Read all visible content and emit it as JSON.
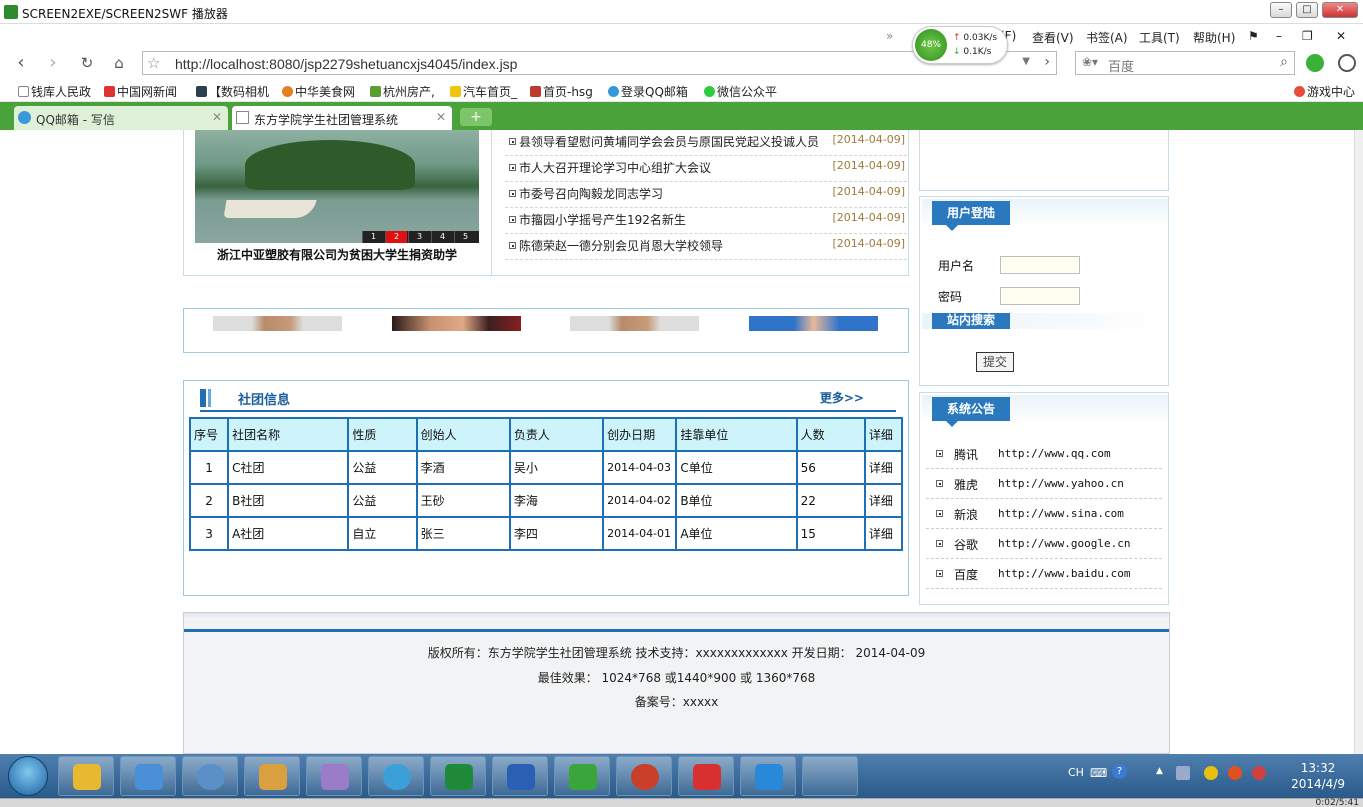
{
  "window": {
    "title": "SCREEN2EXE/SCREEN2SWF 播放器"
  },
  "menu": {
    "items": [
      "(F)",
      "查看(V)",
      "书签(A)",
      "工具(T)",
      "帮助(H)"
    ]
  },
  "nav": {
    "url": "http://localhost:8080/jsp2279shetuancxjs4045/index.jsp",
    "search_placeholder": "百度",
    "speed": {
      "percent": "48%",
      "up": "0.03K/s",
      "down": "0.1K/s"
    }
  },
  "bookmarks": [
    "钱库人民政",
    "中国网新闻",
    "【数码相机",
    "中华美食网",
    "杭州房产,",
    "汽车首页_",
    "首页-hsg",
    "登录QQ邮箱",
    "微信公众平",
    "游戏中心"
  ],
  "tabs": [
    {
      "label": "QQ邮箱 - 写信"
    },
    {
      "label": "东方学院学生社团管理系统"
    }
  ],
  "slideshow": {
    "caption": "浙江中亚塑胶有限公司为贫困大学生捐资助学",
    "numbers": [
      "1",
      "2",
      "3",
      "4",
      "5"
    ],
    "active": 1
  },
  "news": [
    {
      "title": "县领导看望慰问黄埔同学会会员与原国民党起义投诚人员",
      "date": "[2014-04-09]"
    },
    {
      "title": "市人大召开理论学习中心组扩大会议",
      "date": "[2014-04-09]"
    },
    {
      "title": "市委号召向陶毅龙同志学习",
      "date": "[2014-04-09]"
    },
    {
      "title": "市籀园小学摇号产生192名新生",
      "date": "[2014-04-09]"
    },
    {
      "title": "陈德荣赵一德分别会见肖恩大学校领导",
      "date": "[2014-04-09]"
    }
  ],
  "clubs": {
    "title": "社团信息",
    "more": "更多>>",
    "headers": [
      "序号",
      "社团名称",
      "性质",
      "创始人",
      "负责人",
      "创办日期",
      "挂靠单位",
      "人数",
      "详细"
    ],
    "rows": [
      [
        "1",
        "C社团",
        "公益",
        "李酒",
        "吴小",
        "2014-04-03",
        "C单位",
        "56",
        "详细"
      ],
      [
        "2",
        "B社团",
        "公益",
        "王砂",
        "李海",
        "2014-04-02",
        "B单位",
        "22",
        "详细"
      ],
      [
        "3",
        "A社团",
        "自立",
        "张三",
        "李四",
        "2014-04-01",
        "A单位",
        "15",
        "详细"
      ]
    ]
  },
  "login": {
    "title": "用户登陆",
    "username_label": "用户名",
    "password_label": "密码",
    "site_search": "站内搜索",
    "submit": "提交"
  },
  "notice": {
    "title": "系统公告",
    "items": [
      {
        "name": "腾讯",
        "url": "http://www.qq.com"
      },
      {
        "name": "雅虎",
        "url": "http://www.yahoo.cn"
      },
      {
        "name": "新浪",
        "url": "http://www.sina.com"
      },
      {
        "name": "谷歌",
        "url": "http://www.google.cn"
      },
      {
        "name": "百度",
        "url": "http://www.baidu.com"
      }
    ]
  },
  "footer": {
    "line1": "版权所有：东方学院学生社团管理系统 技术支持：xxxxxxxxxxxxx 开发日期： 2014-04-09",
    "line2": "最佳效果： 1024*768 或1440*900 或 1360*768",
    "line3": "备案号：xxxxx"
  },
  "taskbar": {
    "lang": "CH",
    "time": "13:32",
    "date": "2014/4/9",
    "icon_colors": [
      "#e8b830",
      "#4a90d9",
      "#5a8fc8",
      "#d9a040",
      "#9b7cc8",
      "#3ba0d8",
      "#1f8a3a",
      "#2b5fb3",
      "#3aa53a",
      "#c8402a",
      "#d83030",
      "#2a88d8"
    ]
  },
  "status": {
    "playtime": "0:02/5:41"
  }
}
